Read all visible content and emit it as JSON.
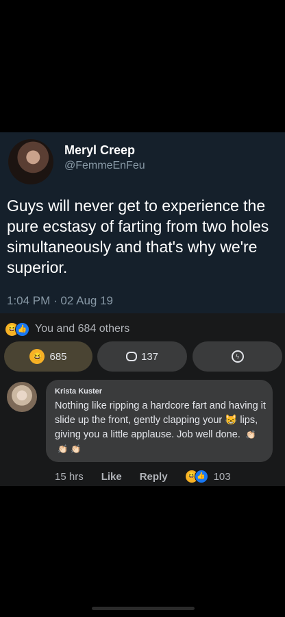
{
  "tweet": {
    "display_name": "Meryl Creep",
    "handle": "@FemmeEnFeu",
    "text": "Guys will never get to experience the pure ecstasy of farting from two holes simultaneously and that's why we're superior.",
    "timestamp": "1:04 PM · 02 Aug 19"
  },
  "post": {
    "reaction_summary": "You and 684 others",
    "reaction_count": "685",
    "comment_count": "137"
  },
  "comment": {
    "author": "Krista Kuster",
    "text_before_emoji": "Nothing like ripping a hardcore fart and having it slide up the front, gently clapping your",
    "text_after_emoji": "lips, giving you a little applause. Job well done.",
    "time": "15 hrs",
    "like_label": "Like",
    "reply_label": "Reply",
    "reaction_count": "103"
  },
  "icons": {
    "haha": "haha-reaction-icon",
    "like": "like-reaction-icon",
    "comment": "comment-bubble-icon",
    "messenger": "messenger-icon",
    "cat": "cat-emoji-icon",
    "clap": "clapping-hands-emoji-icon"
  },
  "colors": {
    "tweet_bg": "#15202b",
    "fb_bg": "#18191a",
    "bubble_bg": "#3a3b3c",
    "haha_yellow": "#f7b125",
    "like_blue": "#1877f2"
  }
}
